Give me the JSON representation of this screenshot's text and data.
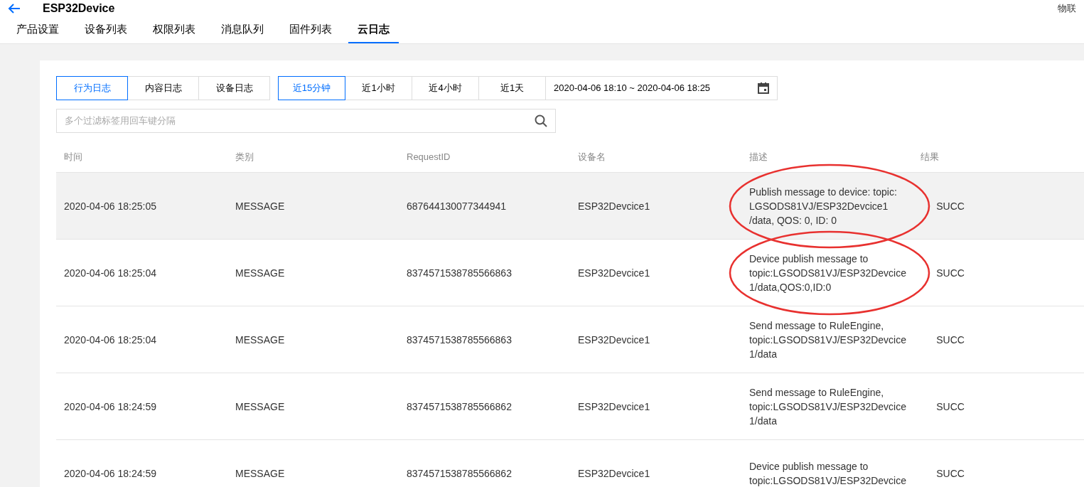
{
  "header": {
    "title": "ESP32Device",
    "right_text": "物联"
  },
  "tabs": [
    {
      "label": "产品设置",
      "selected": false
    },
    {
      "label": "设备列表",
      "selected": false
    },
    {
      "label": "权限列表",
      "selected": false
    },
    {
      "label": "消息队列",
      "selected": false
    },
    {
      "label": "固件列表",
      "selected": false
    },
    {
      "label": "云日志",
      "selected": true
    }
  ],
  "log_types": [
    {
      "label": "行为日志",
      "selected": true
    },
    {
      "label": "内容日志",
      "selected": false
    },
    {
      "label": "设备日志",
      "selected": false
    }
  ],
  "time_ranges": [
    {
      "label": "近15分钟",
      "selected": true
    },
    {
      "label": "近1小时",
      "selected": false
    },
    {
      "label": "近4小时",
      "selected": false
    },
    {
      "label": "近1天",
      "selected": false
    }
  ],
  "date_range": {
    "value": "2020-04-06 18:10 ~ 2020-04-06 18:25"
  },
  "search": {
    "placeholder": "多个过滤标签用回车键分隔"
  },
  "table": {
    "columns": [
      "时间",
      "类别",
      "RequestID",
      "设备名",
      "描述",
      "结果"
    ],
    "rows": [
      {
        "time": "2020-04-06 18:25:05",
        "category": "MESSAGE",
        "request_id": "687644130077344941",
        "device": "ESP32Devcice1",
        "description": "Publish message to device: topic:\nLGSODS81VJ/ESP32Devcice1\n/data, QOS: 0, ID: 0",
        "result": "SUCC",
        "highlighted": true,
        "circled": true
      },
      {
        "time": "2020-04-06 18:25:04",
        "category": "MESSAGE",
        "request_id": "8374571538785566863",
        "device": "ESP32Devcice1",
        "description": "Device publish message to\ntopic:LGSODS81VJ/ESP32Devcice\n1/data,QOS:0,ID:0",
        "result": "SUCC",
        "highlighted": false,
        "circled": true
      },
      {
        "time": "2020-04-06 18:25:04",
        "category": "MESSAGE",
        "request_id": "8374571538785566863",
        "device": "ESP32Devcice1",
        "description": "Send message to RuleEngine,\ntopic:LGSODS81VJ/ESP32Devcice\n1/data",
        "result": "SUCC",
        "highlighted": false,
        "circled": false
      },
      {
        "time": "2020-04-06 18:24:59",
        "category": "MESSAGE",
        "request_id": "8374571538785566862",
        "device": "ESP32Devcice1",
        "description": "Send message to RuleEngine,\ntopic:LGSODS81VJ/ESP32Devcice\n1/data",
        "result": "SUCC",
        "highlighted": false,
        "circled": false
      },
      {
        "time": "2020-04-06 18:24:59",
        "category": "MESSAGE",
        "request_id": "8374571538785566862",
        "device": "ESP32Devcice1",
        "description": "Device publish message to\ntopic:LGSODS81VJ/ESP32Devcice",
        "result": "SUCC",
        "highlighted": false,
        "circled": false
      }
    ]
  }
}
